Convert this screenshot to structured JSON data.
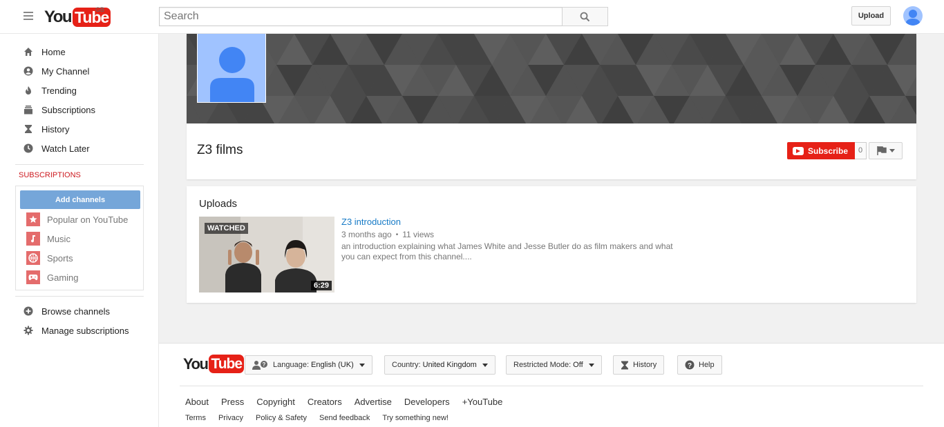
{
  "masthead": {
    "logo_you": "You",
    "logo_tube": "Tube",
    "region": "GB",
    "search_placeholder": "Search",
    "upload_label": "Upload"
  },
  "sidebar": {
    "items": [
      {
        "label": "Home",
        "icon": "home-icon"
      },
      {
        "label": "My Channel",
        "icon": "account-icon"
      },
      {
        "label": "Trending",
        "icon": "flame-icon"
      },
      {
        "label": "Subscriptions",
        "icon": "subscriptions-icon"
      },
      {
        "label": "History",
        "icon": "hourglass-icon"
      },
      {
        "label": "Watch Later",
        "icon": "clock-icon"
      }
    ],
    "subscriptions_title": "SUBSCRIPTIONS",
    "add_channels_label": "Add channels",
    "subscriptions": [
      {
        "label": "Popular on YouTube",
        "icon": "star-icon"
      },
      {
        "label": "Music",
        "icon": "music-note-icon"
      },
      {
        "label": "Sports",
        "icon": "basketball-icon"
      },
      {
        "label": "Gaming",
        "icon": "gamepad-icon"
      }
    ],
    "bottom_items": [
      {
        "label": "Browse channels",
        "icon": "plus-circle-icon"
      },
      {
        "label": "Manage subscriptions",
        "icon": "gear-icon"
      }
    ]
  },
  "channel": {
    "title": "Z3 films",
    "subscribe_label": "Subscribe",
    "subscriber_count": "0"
  },
  "uploads": {
    "title": "Uploads",
    "videos": [
      {
        "title": "Z3 introduction",
        "age": "3 months ago",
        "views": "11 views",
        "description": "an introduction explaining what James White and Jesse Butler do as film makers and what you can expect from this channel....",
        "watched_badge": "WATCHED",
        "duration": "6:29"
      }
    ]
  },
  "footer": {
    "language_label": "Language:",
    "language_value": "English (UK)",
    "country_label": "Country:",
    "country_value": "United Kingdom",
    "restricted_label": "Restricted Mode:",
    "restricted_value": "Off",
    "history_label": "History",
    "help_label": "Help",
    "links_primary": [
      "About",
      "Press",
      "Copyright",
      "Creators",
      "Advertise",
      "Developers",
      "+YouTube"
    ],
    "links_secondary": [
      "Terms",
      "Privacy",
      "Policy & Safety",
      "Send feedback",
      "Try something new!"
    ]
  },
  "colors": {
    "brand_red": "#e62117",
    "link_blue": "#167ac6",
    "add_channels_blue": "#75a6d9",
    "avatar_blue": "#a0c3ff"
  }
}
